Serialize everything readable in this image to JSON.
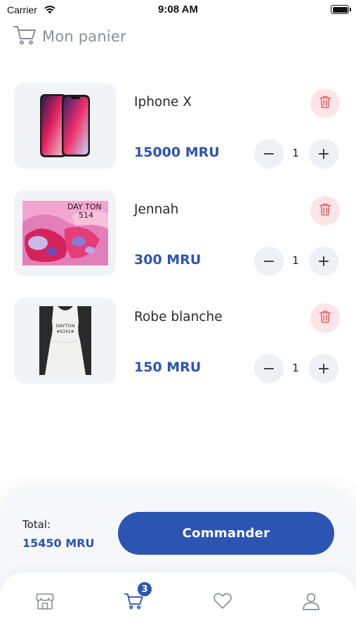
{
  "status_bar": {
    "carrier": "Carrier",
    "time": "9:08 AM"
  },
  "header": {
    "title": "Mon panier",
    "icon": "cart-icon"
  },
  "cart": {
    "items": [
      {
        "name": "Iphone X",
        "price": "15000 MRU",
        "quantity": "1",
        "image": "iphone-x-photo",
        "minus": "−",
        "plus": "+"
      },
      {
        "name": "Jennah",
        "price": "300 MRU",
        "quantity": "1",
        "image": "jennah-fabric-photo",
        "image_text_1": "DAY TON",
        "image_text_2": "514",
        "minus": "−",
        "plus": "+"
      },
      {
        "name": "Robe blanche",
        "price": "150 MRU",
        "quantity": "1",
        "image": "white-dress-photo",
        "image_text_1": "DAYTON",
        "image_text_2": "#6342#",
        "minus": "−",
        "plus": "+"
      }
    ]
  },
  "checkout": {
    "total_label": "Total:",
    "total_value": "15450 MRU",
    "order_button": "Commander"
  },
  "tab_bar": {
    "tabs": [
      "store-icon",
      "cart-icon",
      "heart-icon",
      "user-icon"
    ],
    "cart_badge": "3",
    "active_tab": "cart"
  },
  "colors": {
    "accent": "#2c54b3",
    "delete_bg": "#fde5e7",
    "delete_icon": "#e8606a",
    "thumb_bg": "#f1f3f7",
    "title_gray": "#8a8f98"
  }
}
